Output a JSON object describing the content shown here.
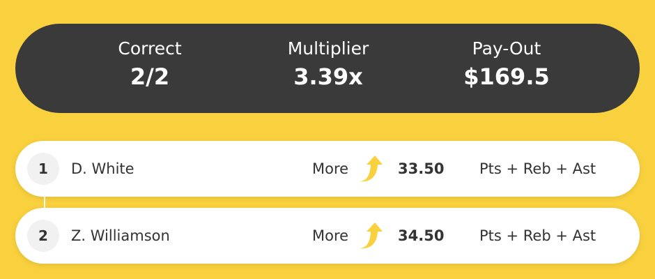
{
  "summary": {
    "correct_label": "Correct",
    "correct_value": "2/2",
    "multiplier_label": "Multiplier",
    "multiplier_value": "3.39x",
    "payout_label": "Pay-Out",
    "payout_value": "$169.5"
  },
  "picks": [
    {
      "number": "1",
      "player": "D. White",
      "direction": "More",
      "direction_icon": "arrow-up-icon",
      "line": "33.50",
      "stat": "Pts + Reb + Ast"
    },
    {
      "number": "2",
      "player": "Z. Williamson",
      "direction": "More",
      "direction_icon": "arrow-up-icon",
      "line": "34.50",
      "stat": "Pts + Reb + Ast"
    }
  ],
  "colors": {
    "background": "#f9d13e",
    "summary_bg": "#3a3a3a",
    "arrow": "#f9d13e",
    "text": "#333333"
  }
}
